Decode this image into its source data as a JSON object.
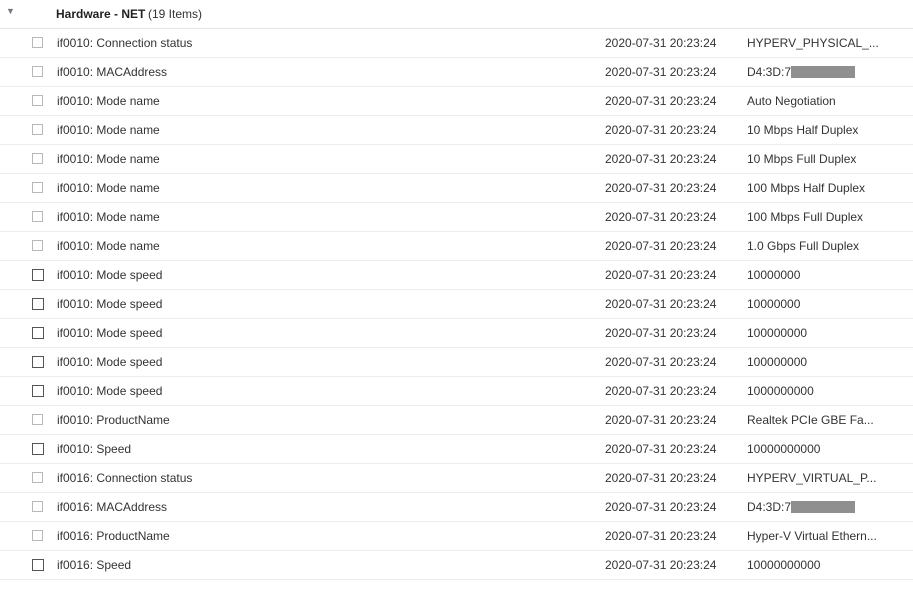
{
  "group": {
    "title": "Hardware - NET",
    "count": "(19 Items)"
  },
  "rows": [
    {
      "name": "if0010: Connection status",
      "time": "2020-07-31 20:23:24",
      "value": "HYPERV_PHYSICAL_...",
      "checkbox": "light"
    },
    {
      "name": "if0010: MACAddress",
      "time": "2020-07-31 20:23:24",
      "value": "D4:3D:7",
      "redacted": true,
      "checkbox": "light"
    },
    {
      "name": "if0010: Mode name",
      "time": "2020-07-31 20:23:24",
      "value": "Auto Negotiation",
      "checkbox": "light"
    },
    {
      "name": "if0010: Mode name",
      "time": "2020-07-31 20:23:24",
      "value": "10 Mbps Half Duplex",
      "checkbox": "light"
    },
    {
      "name": "if0010: Mode name",
      "time": "2020-07-31 20:23:24",
      "value": "10 Mbps Full Duplex",
      "checkbox": "light"
    },
    {
      "name": "if0010: Mode name",
      "time": "2020-07-31 20:23:24",
      "value": "100 Mbps Half Duplex",
      "checkbox": "light"
    },
    {
      "name": "if0010: Mode name",
      "time": "2020-07-31 20:23:24",
      "value": "100 Mbps Full Duplex",
      "checkbox": "light"
    },
    {
      "name": "if0010: Mode name",
      "time": "2020-07-31 20:23:24",
      "value": "1.0 Gbps Full Duplex",
      "checkbox": "light"
    },
    {
      "name": "if0010: Mode speed",
      "time": "2020-07-31 20:23:24",
      "value": "10000000",
      "checkbox": "dark"
    },
    {
      "name": "if0010: Mode speed",
      "time": "2020-07-31 20:23:24",
      "value": "10000000",
      "checkbox": "dark"
    },
    {
      "name": "if0010: Mode speed",
      "time": "2020-07-31 20:23:24",
      "value": "100000000",
      "checkbox": "dark"
    },
    {
      "name": "if0010: Mode speed",
      "time": "2020-07-31 20:23:24",
      "value": "100000000",
      "checkbox": "dark"
    },
    {
      "name": "if0010: Mode speed",
      "time": "2020-07-31 20:23:24",
      "value": "1000000000",
      "checkbox": "dark"
    },
    {
      "name": "if0010: ProductName",
      "time": "2020-07-31 20:23:24",
      "value": "Realtek PCIe GBE Fa...",
      "checkbox": "light"
    },
    {
      "name": "if0010: Speed",
      "time": "2020-07-31 20:23:24",
      "value": "10000000000",
      "checkbox": "dark"
    },
    {
      "name": "if0016: Connection status",
      "time": "2020-07-31 20:23:24",
      "value": "HYPERV_VIRTUAL_P...",
      "checkbox": "light"
    },
    {
      "name": "if0016: MACAddress",
      "time": "2020-07-31 20:23:24",
      "value": "D4:3D:7",
      "redacted": true,
      "checkbox": "light"
    },
    {
      "name": "if0016: ProductName",
      "time": "2020-07-31 20:23:24",
      "value": "Hyper-V Virtual Ethern...",
      "checkbox": "light"
    },
    {
      "name": "if0016: Speed",
      "time": "2020-07-31 20:23:24",
      "value": "10000000000",
      "checkbox": "dark"
    }
  ]
}
